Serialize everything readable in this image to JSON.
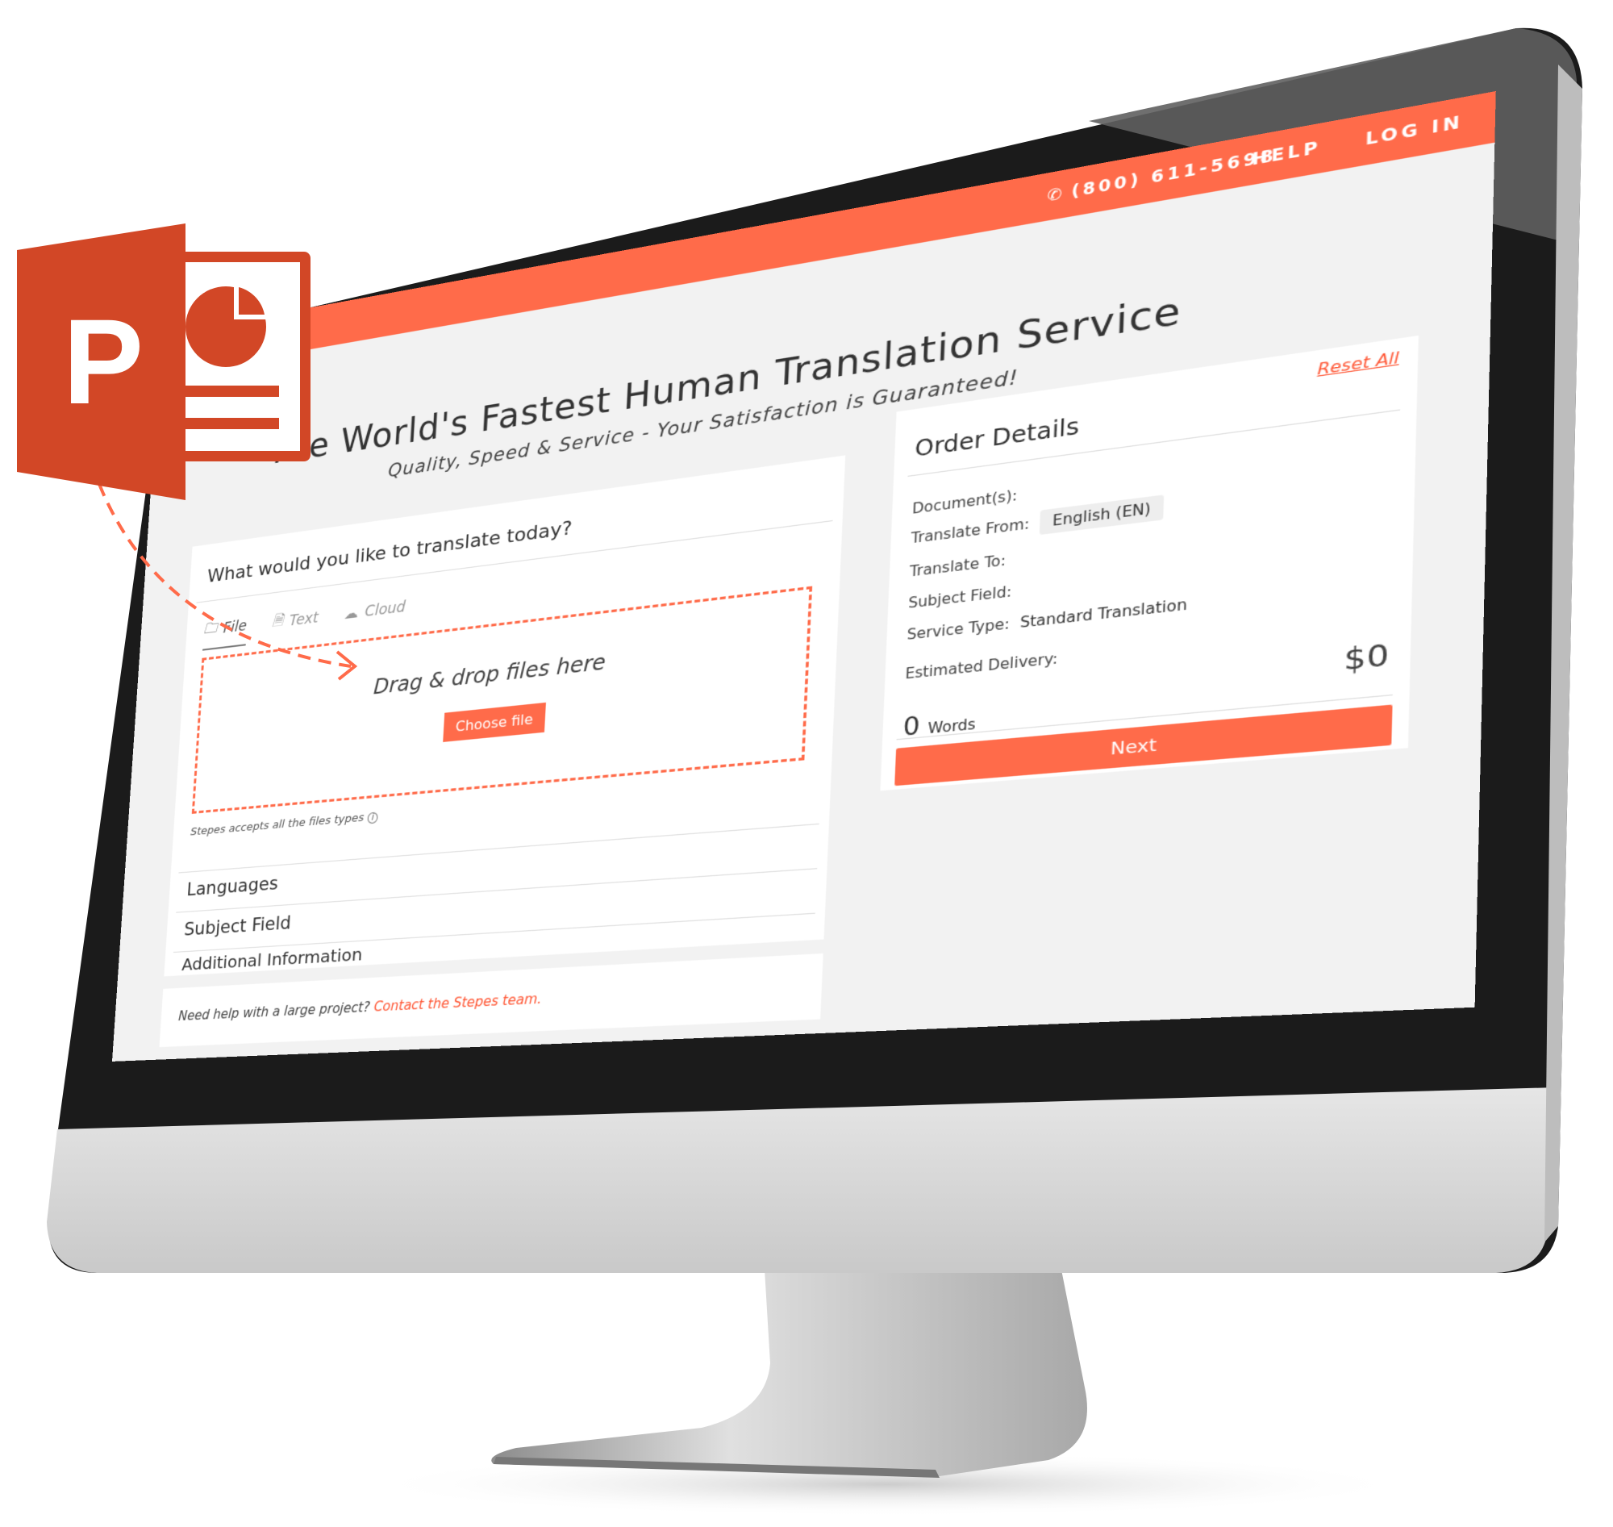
{
  "colors": {
    "accent": "#ff6b4a",
    "bezel": "#1b1b1b",
    "background": "#f2f2f2",
    "ppt": "#d24726"
  },
  "topbar": {
    "phone_icon": "phone-icon",
    "phone": "(800) 611-5698",
    "help": "HELP",
    "login": "LOG IN"
  },
  "hero": {
    "title": "The World's Fastest Human Translation Service",
    "subtitle": "Quality, Speed & Service - Your Satisfaction is Guaranteed!"
  },
  "upload": {
    "question": "What would you like to translate today?",
    "tabs": [
      {
        "label": "File",
        "icon": "folder-icon",
        "active": true
      },
      {
        "label": "Text",
        "icon": "document-icon"
      },
      {
        "label": "Cloud",
        "icon": "cloud-icon"
      }
    ],
    "drop_text": "Drag & drop files here",
    "choose_file": "Choose file",
    "accepts": "Stepes accepts all the files types",
    "info_icon": "i"
  },
  "sections": [
    "Languages",
    "Subject Field",
    "Additional Information"
  ],
  "footer": {
    "text": "Need help with a large project?",
    "link": "Contact the Stepes team."
  },
  "order": {
    "title": "Order Details",
    "reset": "Reset All",
    "documents_label": "Document(s):",
    "from_label": "Translate From:",
    "from_value": "English (EN)",
    "to_label": "Translate To:",
    "subject_label": "Subject Field:",
    "service_label": "Service Type:",
    "service_value": "Standard Translation",
    "delivery_label": "Estimated Delivery:",
    "price": "$0",
    "word_count": "0",
    "words_label": "Words",
    "next": "Next"
  },
  "logo": {
    "letter": "P",
    "name": "powerpoint-logo"
  }
}
